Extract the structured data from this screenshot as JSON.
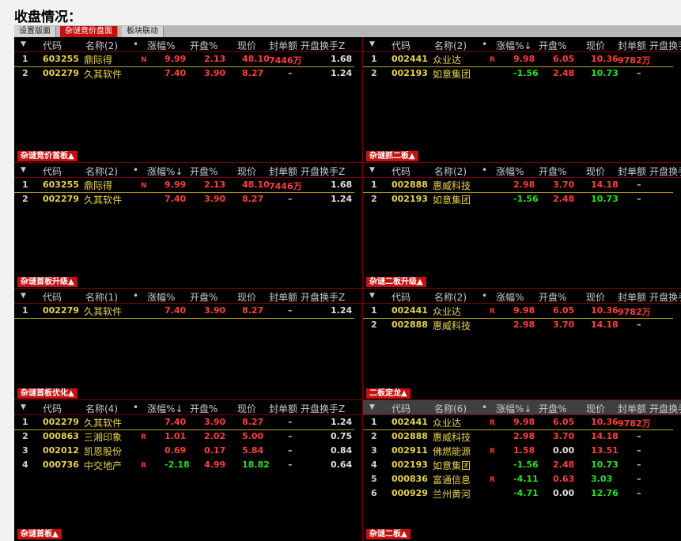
{
  "heading": "收盘情况：",
  "tabs": [
    {
      "label": "设置版面",
      "active": false
    },
    {
      "label": "杂谜竞价盘面",
      "active": true
    },
    {
      "label": "板块联动",
      "active": false
    }
  ],
  "headers": {
    "code": "代码",
    "up_arrow": "▼",
    "dot": "•",
    "open_pct": "开盘%",
    "price": "现价",
    "seal": "封单额",
    "turnover": "开盘换手Z"
  },
  "panels": [
    {
      "name_header": "名称(2)",
      "change_header": "涨幅%",
      "rows": [
        {
          "idx": "1",
          "code": "603255",
          "name": "鼎际得",
          "badge": "N",
          "chg": "9.99",
          "chg_dir": "up",
          "open": "2.13",
          "open_dir": "up",
          "price": "48.10",
          "price_dir": "up",
          "seal": "7446万",
          "turn": "1.68"
        },
        {
          "idx": "2",
          "code": "002279",
          "name": "久其软件",
          "badge": "",
          "chg": "7.40",
          "chg_dir": "up",
          "open": "3.90",
          "open_dir": "up",
          "price": "8.27",
          "price_dir": "up",
          "seal": "–",
          "turn": "1.24"
        }
      ]
    },
    {
      "name_header": "名称(2)",
      "change_header": "涨幅%↓",
      "rows": [
        {
          "idx": "1",
          "code": "002441",
          "name": "众业达",
          "badge": "R",
          "chg": "9.98",
          "chg_dir": "up",
          "open": "6.05",
          "open_dir": "up",
          "price": "10.36",
          "price_dir": "up",
          "seal": "9782万",
          "turn": ""
        },
        {
          "idx": "2",
          "code": "002193",
          "name": "如意集团",
          "badge": "",
          "chg": "-1.56",
          "chg_dir": "dn",
          "open": "2.48",
          "open_dir": "up",
          "price": "10.73",
          "price_dir": "dn",
          "seal": "–",
          "turn": ""
        }
      ]
    },
    {
      "title": "杂谜竞价首板▲",
      "name_header": "名称(2)",
      "change_header": "涨幅%↓",
      "rows": [
        {
          "idx": "1",
          "code": "603255",
          "name": "鼎际得",
          "badge": "N",
          "chg": "9.99",
          "chg_dir": "up",
          "open": "2.13",
          "open_dir": "up",
          "price": "48.10",
          "price_dir": "up",
          "seal": "7446万",
          "turn": "1.68"
        },
        {
          "idx": "2",
          "code": "002279",
          "name": "久其软件",
          "badge": "",
          "chg": "7.40",
          "chg_dir": "up",
          "open": "3.90",
          "open_dir": "up",
          "price": "8.27",
          "price_dir": "up",
          "seal": "–",
          "turn": "1.24"
        }
      ]
    },
    {
      "title": "杂谜抓二板▲",
      "name_header": "名称(2)",
      "change_header": "涨幅%",
      "rows": [
        {
          "idx": "1",
          "code": "002888",
          "name": "惠威科技",
          "badge": "",
          "chg": "2.98",
          "chg_dir": "up",
          "open": "3.70",
          "open_dir": "up",
          "price": "14.18",
          "price_dir": "up",
          "seal": "–",
          "turn": ""
        },
        {
          "idx": "2",
          "code": "002193",
          "name": "如意集团",
          "badge": "",
          "chg": "-1.56",
          "chg_dir": "dn",
          "open": "2.48",
          "open_dir": "up",
          "price": "10.73",
          "price_dir": "dn",
          "seal": "–",
          "turn": ""
        }
      ]
    },
    {
      "title": "杂谜首板升级▲",
      "name_header": "名称(1)",
      "change_header": "涨幅%",
      "rows": [
        {
          "idx": "1",
          "code": "002279",
          "name": "久其软件",
          "badge": "",
          "chg": "7.40",
          "chg_dir": "up",
          "open": "3.90",
          "open_dir": "up",
          "price": "8.27",
          "price_dir": "up",
          "seal": "–",
          "turn": "1.24"
        }
      ]
    },
    {
      "title": "杂谜二板升级▲",
      "name_header": "名称(2)",
      "change_header": "涨幅%",
      "rows": [
        {
          "idx": "1",
          "code": "002441",
          "name": "众业达",
          "badge": "R",
          "chg": "9.98",
          "chg_dir": "up",
          "open": "6.05",
          "open_dir": "up",
          "price": "10.36",
          "price_dir": "up",
          "seal": "9782万",
          "turn": ""
        },
        {
          "idx": "2",
          "code": "002888",
          "name": "惠威科技",
          "badge": "",
          "chg": "2.98",
          "chg_dir": "up",
          "open": "3.70",
          "open_dir": "up",
          "price": "14.18",
          "price_dir": "up",
          "seal": "–",
          "turn": ""
        }
      ]
    },
    {
      "title": "杂谜首板优化▲",
      "name_header": "名称(4)",
      "change_header": "涨幅%↓",
      "rows": [
        {
          "idx": "1",
          "code": "002279",
          "name": "久其软件",
          "badge": "",
          "chg": "7.40",
          "chg_dir": "up",
          "open": "3.90",
          "open_dir": "up",
          "price": "8.27",
          "price_dir": "up",
          "seal": "–",
          "turn": "1.24"
        },
        {
          "idx": "2",
          "code": "000863",
          "name": "三湘印象",
          "badge": "R",
          "chg": "1.01",
          "chg_dir": "up",
          "open": "2.02",
          "open_dir": "up",
          "price": "5.00",
          "price_dir": "up",
          "seal": "–",
          "turn": "0.75"
        },
        {
          "idx": "3",
          "code": "002012",
          "name": "凯恩股份",
          "badge": "",
          "chg": "0.69",
          "chg_dir": "up",
          "open": "0.17",
          "open_dir": "up",
          "price": "5.84",
          "price_dir": "up",
          "seal": "–",
          "turn": "0.84"
        },
        {
          "idx": "4",
          "code": "000736",
          "name": "中交地产",
          "badge": "R",
          "chg": "-2.18",
          "chg_dir": "dn",
          "open": "4.99",
          "open_dir": "up",
          "price": "18.82",
          "price_dir": "dn",
          "seal": "–",
          "turn": "0.64"
        }
      ]
    },
    {
      "title": "二板定龙▲",
      "name_header": "名称(6)",
      "change_header": "涨幅%↓",
      "rows": [
        {
          "idx": "1",
          "code": "002441",
          "name": "众业达",
          "badge": "R",
          "chg": "9.98",
          "chg_dir": "up",
          "open": "6.05",
          "open_dir": "up",
          "price": "10.36",
          "price_dir": "up",
          "seal": "9782万",
          "turn": ""
        },
        {
          "idx": "2",
          "code": "002888",
          "name": "惠威科技",
          "badge": "",
          "chg": "2.98",
          "chg_dir": "up",
          "open": "3.70",
          "open_dir": "up",
          "price": "14.18",
          "price_dir": "up",
          "seal": "–",
          "turn": ""
        },
        {
          "idx": "3",
          "code": "002911",
          "name": "佛燃能源",
          "badge": "R",
          "chg": "1.58",
          "chg_dir": "up",
          "open": "0.00",
          "open_dir": "eq",
          "price": "13.51",
          "price_dir": "up",
          "seal": "–",
          "turn": ""
        },
        {
          "idx": "4",
          "code": "002193",
          "name": "如意集团",
          "badge": "",
          "chg": "-1.56",
          "chg_dir": "dn",
          "open": "2.48",
          "open_dir": "up",
          "price": "10.73",
          "price_dir": "dn",
          "seal": "–",
          "turn": ""
        },
        {
          "idx": "5",
          "code": "000836",
          "name": "富通信息",
          "badge": "R",
          "chg": "-4.11",
          "chg_dir": "dn",
          "open": "0.63",
          "open_dir": "up",
          "price": "3.03",
          "price_dir": "dn",
          "seal": "–",
          "turn": ""
        },
        {
          "idx": "6",
          "code": "000929",
          "name": "兰州黄河",
          "badge": "",
          "chg": "-4.71",
          "chg_dir": "dn",
          "open": "0.00",
          "open_dir": "eq",
          "price": "12.76",
          "price_dir": "dn",
          "seal": "–",
          "turn": ""
        }
      ]
    }
  ],
  "bottom_titles": [
    "杂谜首板▲",
    "杂谜二板▲"
  ]
}
